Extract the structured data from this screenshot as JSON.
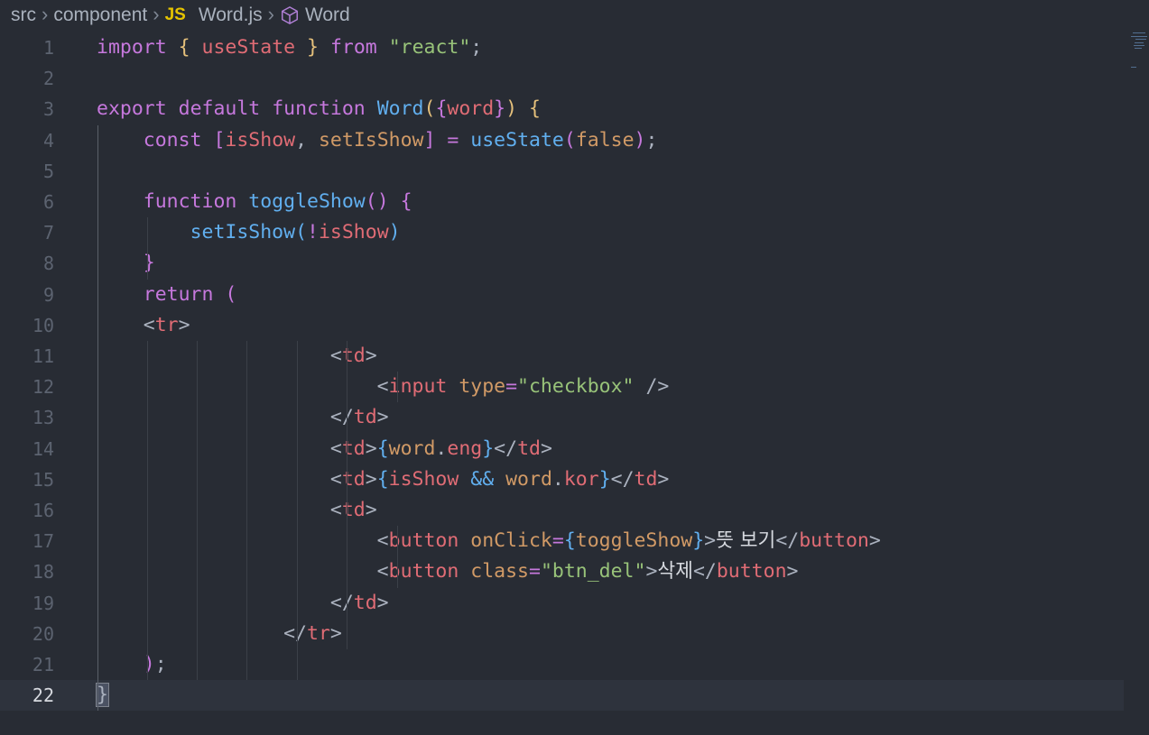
{
  "breadcrumb": {
    "items": [
      "src",
      "component",
      "Word.js",
      "Word"
    ],
    "file_badge": "JS"
  },
  "editor": {
    "current_line": 22,
    "line_numbers": [
      "1",
      "2",
      "3",
      "4",
      "5",
      "6",
      "7",
      "8",
      "9",
      "10",
      "11",
      "12",
      "13",
      "14",
      "15",
      "16",
      "17",
      "18",
      "19",
      "20",
      "21",
      "22"
    ],
    "lines": [
      [
        [
          "kw",
          "import"
        ],
        [
          "pun",
          " "
        ],
        [
          "br1",
          "{"
        ],
        [
          "pun",
          " "
        ],
        [
          "var",
          "useState"
        ],
        [
          "pun",
          " "
        ],
        [
          "br1",
          "}"
        ],
        [
          "pun",
          " "
        ],
        [
          "kw",
          "from"
        ],
        [
          "pun",
          " "
        ],
        [
          "str",
          "\"react\""
        ],
        [
          "pun",
          ";"
        ]
      ],
      [],
      [
        [
          "kw",
          "export"
        ],
        [
          "pun",
          " "
        ],
        [
          "kw",
          "default"
        ],
        [
          "pun",
          " "
        ],
        [
          "kw",
          "function"
        ],
        [
          "pun",
          " "
        ],
        [
          "fn",
          "Word"
        ],
        [
          "br1",
          "("
        ],
        [
          "br2",
          "{"
        ],
        [
          "var",
          "word"
        ],
        [
          "br2",
          "}"
        ],
        [
          "br1",
          ")"
        ],
        [
          "pun",
          " "
        ],
        [
          "br1",
          "{"
        ]
      ],
      [
        [
          "pun",
          "    "
        ],
        [
          "kw",
          "const"
        ],
        [
          "pun",
          " "
        ],
        [
          "br2",
          "["
        ],
        [
          "var",
          "isShow"
        ],
        [
          "pun",
          ", "
        ],
        [
          "attr",
          "setIsShow"
        ],
        [
          "br2",
          "]"
        ],
        [
          "pun",
          " "
        ],
        [
          "kw",
          "="
        ],
        [
          "pun",
          " "
        ],
        [
          "fn",
          "useState"
        ],
        [
          "br2",
          "("
        ],
        [
          "attr",
          "false"
        ],
        [
          "br2",
          ")"
        ],
        [
          "pun",
          ";"
        ]
      ],
      [],
      [
        [
          "pun",
          "    "
        ],
        [
          "kw",
          "function"
        ],
        [
          "pun",
          " "
        ],
        [
          "fn",
          "toggleShow"
        ],
        [
          "br2",
          "()"
        ],
        [
          "pun",
          " "
        ],
        [
          "br2",
          "{"
        ]
      ],
      [
        [
          "pun",
          "        "
        ],
        [
          "fn",
          "setIsShow"
        ],
        [
          "br3",
          "("
        ],
        [
          "kw",
          "!"
        ],
        [
          "var",
          "isShow"
        ],
        [
          "br3",
          ")"
        ]
      ],
      [
        [
          "pun",
          "    "
        ],
        [
          "br2",
          "}"
        ]
      ],
      [
        [
          "pun",
          "    "
        ],
        [
          "kw",
          "return"
        ],
        [
          "pun",
          " "
        ],
        [
          "br2",
          "("
        ]
      ],
      [
        [
          "pun",
          "    "
        ],
        [
          "pun",
          "<"
        ],
        [
          "tag",
          "tr"
        ],
        [
          "pun",
          ">"
        ]
      ],
      [
        [
          "pun",
          "                    "
        ],
        [
          "pun",
          "<"
        ],
        [
          "tag",
          "td"
        ],
        [
          "pun",
          ">"
        ]
      ],
      [
        [
          "pun",
          "                        "
        ],
        [
          "pun",
          "<"
        ],
        [
          "tag",
          "input"
        ],
        [
          "pun",
          " "
        ],
        [
          "attr",
          "type"
        ],
        [
          "kw",
          "="
        ],
        [
          "str",
          "\"checkbox\""
        ],
        [
          "pun",
          " />"
        ]
      ],
      [
        [
          "pun",
          "                    "
        ],
        [
          "pun",
          "</"
        ],
        [
          "tag",
          "td"
        ],
        [
          "pun",
          ">"
        ]
      ],
      [
        [
          "pun",
          "                    "
        ],
        [
          "pun",
          "<"
        ],
        [
          "tag",
          "td"
        ],
        [
          "pun",
          ">"
        ],
        [
          "br3",
          "{"
        ],
        [
          "attr",
          "word"
        ],
        [
          "pun",
          "."
        ],
        [
          "var",
          "eng"
        ],
        [
          "br3",
          "}"
        ],
        [
          "pun",
          "</"
        ],
        [
          "tag",
          "td"
        ],
        [
          "pun",
          ">"
        ]
      ],
      [
        [
          "pun",
          "                    "
        ],
        [
          "pun",
          "<"
        ],
        [
          "tag",
          "td"
        ],
        [
          "pun",
          ">"
        ],
        [
          "br3",
          "{"
        ],
        [
          "var",
          "isShow"
        ],
        [
          "pun",
          " "
        ],
        [
          "fn",
          "&&"
        ],
        [
          "pun",
          " "
        ],
        [
          "attr",
          "word"
        ],
        [
          "pun",
          "."
        ],
        [
          "var",
          "kor"
        ],
        [
          "br3",
          "}"
        ],
        [
          "pun",
          "</"
        ],
        [
          "tag",
          "td"
        ],
        [
          "pun",
          ">"
        ]
      ],
      [
        [
          "pun",
          "                    "
        ],
        [
          "pun",
          "<"
        ],
        [
          "tag",
          "td"
        ],
        [
          "pun",
          ">"
        ]
      ],
      [
        [
          "pun",
          "                        "
        ],
        [
          "pun",
          "<"
        ],
        [
          "tag",
          "button"
        ],
        [
          "pun",
          " "
        ],
        [
          "attr",
          "onClick"
        ],
        [
          "kw",
          "="
        ],
        [
          "br3",
          "{"
        ],
        [
          "attr",
          "toggleShow"
        ],
        [
          "br3",
          "}"
        ],
        [
          "pun",
          ">"
        ],
        [
          "txt",
          "뜻 보기"
        ],
        [
          "pun",
          "</"
        ],
        [
          "tag",
          "button"
        ],
        [
          "pun",
          ">"
        ]
      ],
      [
        [
          "pun",
          "                        "
        ],
        [
          "pun",
          "<"
        ],
        [
          "tag",
          "button"
        ],
        [
          "pun",
          " "
        ],
        [
          "attr",
          "class"
        ],
        [
          "kw",
          "="
        ],
        [
          "str",
          "\"btn_del\""
        ],
        [
          "pun",
          ">"
        ],
        [
          "txt",
          "삭제"
        ],
        [
          "pun",
          "</"
        ],
        [
          "tag",
          "button"
        ],
        [
          "pun",
          ">"
        ]
      ],
      [
        [
          "pun",
          "                    "
        ],
        [
          "pun",
          "</"
        ],
        [
          "tag",
          "td"
        ],
        [
          "pun",
          ">"
        ]
      ],
      [
        [
          "pun",
          "                "
        ],
        [
          "pun",
          "</"
        ],
        [
          "tag",
          "tr"
        ],
        [
          "pun",
          ">"
        ]
      ],
      [
        [
          "pun",
          "    "
        ],
        [
          "br2",
          ")"
        ],
        [
          "pun",
          ";"
        ]
      ],
      [
        [
          "cursor",
          "}"
        ]
      ]
    ]
  }
}
